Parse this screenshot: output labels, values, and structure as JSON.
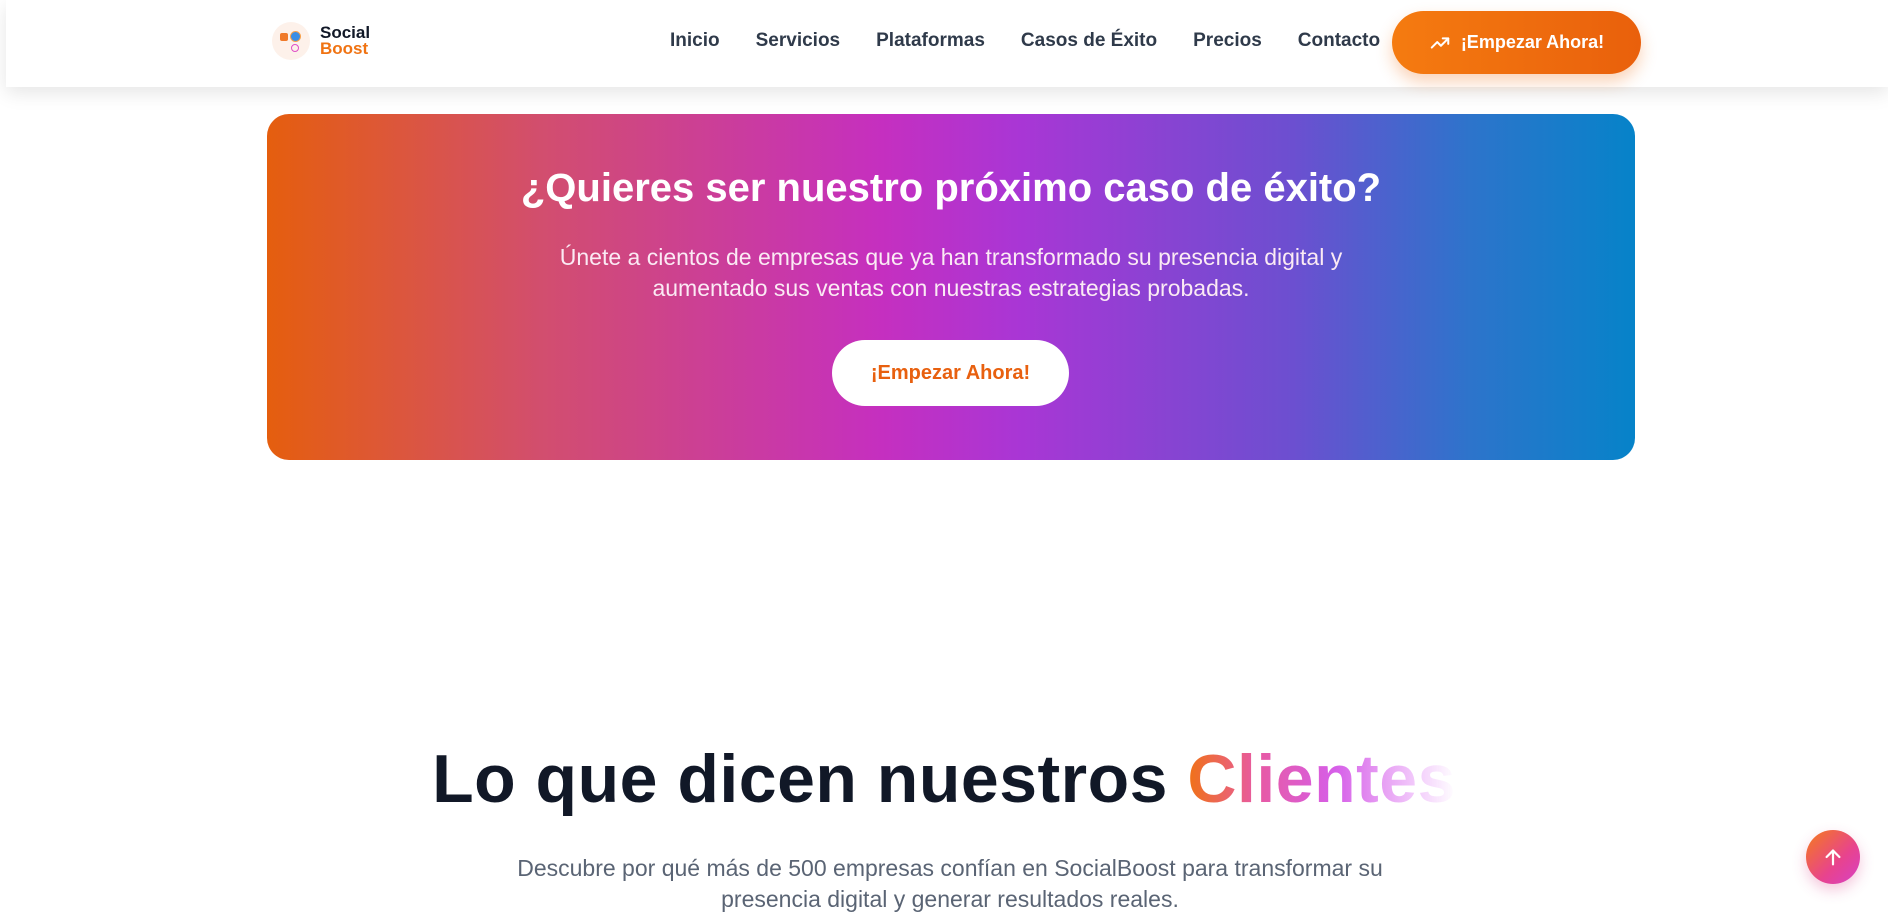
{
  "header": {
    "logo": {
      "line1": "Social",
      "line2": "Boost"
    },
    "nav": [
      {
        "label": "Inicio"
      },
      {
        "label": "Servicios"
      },
      {
        "label": "Plataformas"
      },
      {
        "label": "Casos de Éxito"
      },
      {
        "label": "Precios"
      },
      {
        "label": "Contacto"
      }
    ],
    "cta_label": "¡Empezar Ahora!",
    "cta_icon": "trending-up-icon"
  },
  "banner": {
    "title": "¿Quieres ser nuestro próximo caso de éxito?",
    "text": "Únete a cientos de empresas que ya han transformado su presencia digital y aumentado sus ventas con nuestras estrategias probadas.",
    "button_label": "¡Empezar Ahora!"
  },
  "testimonials": {
    "title_main": "Lo que dicen nuestros ",
    "title_highlight": "Clientes",
    "subtitle": "Descubre por qué más de 500 empresas confían en SocialBoost para transformar su presencia digital y generar resultados reales."
  },
  "scroll_top": {
    "icon": "arrow-up-icon"
  },
  "colors": {
    "brand_orange": "#f07312",
    "text_dark": "#111827",
    "gradient_start": "#e55e0e",
    "gradient_mid": "#c52fc0",
    "gradient_end": "#0683c9"
  }
}
